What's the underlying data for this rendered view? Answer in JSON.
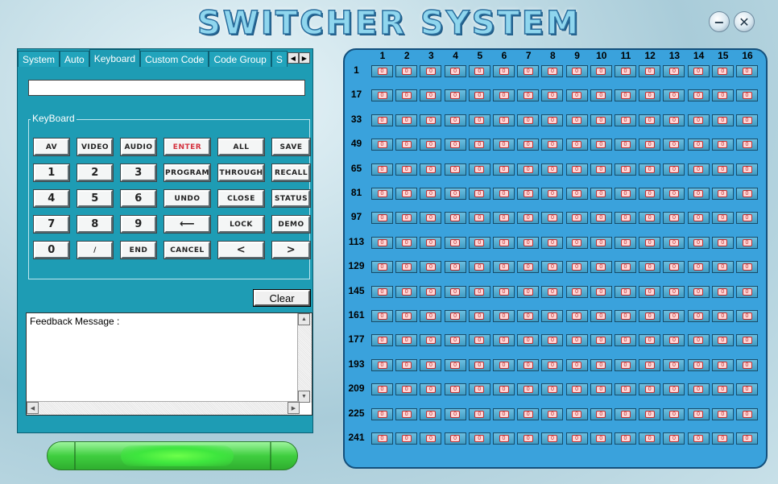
{
  "window": {
    "title": "SWITCHER SYSTEM",
    "minimize_glyph": "−",
    "close_glyph": "✕"
  },
  "tabs": [
    {
      "label": "System",
      "active": false
    },
    {
      "label": "Auto",
      "active": false
    },
    {
      "label": "Keyboard",
      "active": true
    },
    {
      "label": "Custom Code",
      "active": false
    },
    {
      "label": "Code Group",
      "active": false
    },
    {
      "label": "S",
      "active": false
    }
  ],
  "tab_scroll": {
    "left": "◀",
    "right": "▶"
  },
  "command_input": {
    "value": ""
  },
  "keyboard": {
    "group_label": "KeyBoard",
    "keys": [
      {
        "label": "AV",
        "name": "key-av",
        "style": "normal"
      },
      {
        "label": "VIDEO",
        "name": "key-video",
        "style": "normal"
      },
      {
        "label": "AUDIO",
        "name": "key-audio",
        "style": "normal"
      },
      {
        "label": "ENTER",
        "name": "key-enter",
        "style": "red"
      },
      {
        "label": "ALL",
        "name": "key-all",
        "style": "normal"
      },
      {
        "label": "SAVE",
        "name": "key-save",
        "style": "normal"
      },
      {
        "label": "1",
        "name": "key-1",
        "style": "num"
      },
      {
        "label": "2",
        "name": "key-2",
        "style": "num"
      },
      {
        "label": "3",
        "name": "key-3",
        "style": "num"
      },
      {
        "label": "PROGRAM",
        "name": "key-program",
        "style": "normal"
      },
      {
        "label": "THROUGH",
        "name": "key-through",
        "style": "normal"
      },
      {
        "label": "RECALL",
        "name": "key-recall",
        "style": "normal"
      },
      {
        "label": "4",
        "name": "key-4",
        "style": "num"
      },
      {
        "label": "5",
        "name": "key-5",
        "style": "num"
      },
      {
        "label": "6",
        "name": "key-6",
        "style": "num"
      },
      {
        "label": "UNDO",
        "name": "key-undo",
        "style": "normal"
      },
      {
        "label": "CLOSE",
        "name": "key-close",
        "style": "normal"
      },
      {
        "label": "STATUS",
        "name": "key-status",
        "style": "normal"
      },
      {
        "label": "7",
        "name": "key-7",
        "style": "num"
      },
      {
        "label": "8",
        "name": "key-8",
        "style": "num"
      },
      {
        "label": "9",
        "name": "key-9",
        "style": "num"
      },
      {
        "label": "⟵",
        "name": "key-backspace",
        "style": "num"
      },
      {
        "label": "LOCK",
        "name": "key-lock",
        "style": "normal"
      },
      {
        "label": "DEMO",
        "name": "key-demo",
        "style": "normal"
      },
      {
        "label": "0",
        "name": "key-0",
        "style": "num"
      },
      {
        "label": "/",
        "name": "key-slash",
        "style": "normal"
      },
      {
        "label": "END",
        "name": "key-end",
        "style": "normal"
      },
      {
        "label": "CANCEL",
        "name": "key-cancel",
        "style": "normal"
      },
      {
        "label": "<",
        "name": "key-prev",
        "style": "num"
      },
      {
        "label": ">",
        "name": "key-next",
        "style": "num"
      }
    ]
  },
  "clear_button": {
    "label": "Clear"
  },
  "feedback": {
    "label": "Feedback Message :"
  },
  "scrollbar_glyphs": {
    "up": "▲",
    "down": "▼",
    "left": "◀",
    "right": "▶"
  },
  "matrix": {
    "column_headers": [
      "1",
      "2",
      "3",
      "4",
      "5",
      "6",
      "7",
      "8",
      "9",
      "10",
      "11",
      "12",
      "13",
      "14",
      "15",
      "16"
    ],
    "row_headers": [
      "1",
      "17",
      "33",
      "49",
      "65",
      "81",
      "97",
      "113",
      "129",
      "145",
      "161",
      "177",
      "193",
      "209",
      "225",
      "241"
    ],
    "cell_value": "0"
  },
  "colors": {
    "panel": "#1e9cb4",
    "matrix_bg": "#3aa2dc",
    "enter_key_text": "#d4313d",
    "status_bar": "#3fce3f"
  }
}
